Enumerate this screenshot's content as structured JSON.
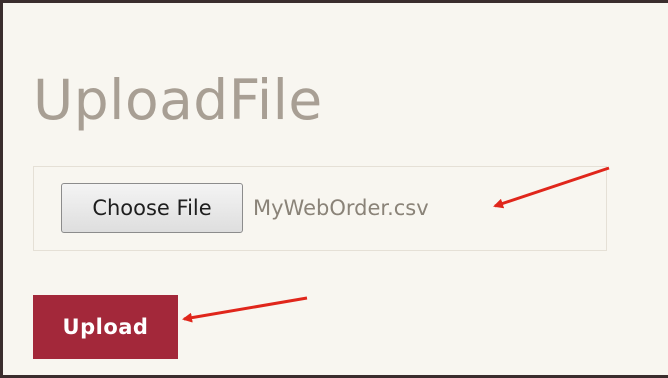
{
  "page": {
    "title": "UploadFile"
  },
  "file_input": {
    "button_label": "Choose File",
    "selected_file": "MyWebOrder.csv"
  },
  "actions": {
    "upload_label": "Upload"
  },
  "annotations": {
    "arrow_color": "#e0261b"
  },
  "colors": {
    "background": "#f8f6f0",
    "title": "#a89f94",
    "upload_button": "#a3283a",
    "frame_border": "#3a2d2d"
  }
}
